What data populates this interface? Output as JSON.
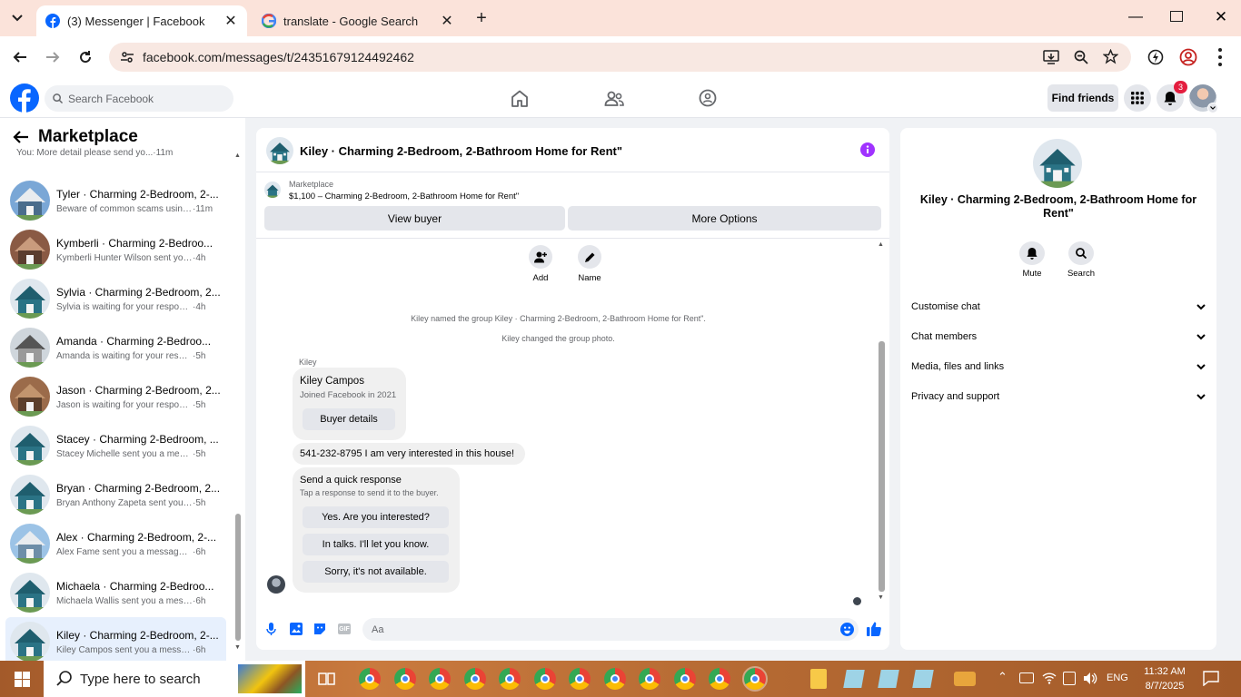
{
  "browser": {
    "tabs": [
      {
        "title": "(3) Messenger | Facebook",
        "active": true
      },
      {
        "title": "translate - Google Search",
        "active": false
      }
    ],
    "url": "facebook.com/messages/t/24351679124492462"
  },
  "header": {
    "search_placeholder": "Search Facebook",
    "find_friends": "Find friends",
    "notification_count": "3"
  },
  "left": {
    "title": "Marketplace",
    "top_preview": "You: More detail please send yo...",
    "top_time": "·11m",
    "conversations": [
      {
        "name": "Tyler · Charming 2-Bedroom, 2-...",
        "preview": "Beware of common scams using...",
        "time": "·11m"
      },
      {
        "name": "Kymberli · Charming 2-Bedroo...",
        "preview": "Kymberli Hunter Wilson sent you a...",
        "time": "·4h"
      },
      {
        "name": "Sylvia · Charming 2-Bedroom, 2...",
        "preview": "Sylvia is waiting for your response.",
        "time": "·4h"
      },
      {
        "name": "Amanda · Charming 2-Bedroo...",
        "preview": "Amanda is waiting for your respo...",
        "time": "·5h"
      },
      {
        "name": "Jason · Charming 2-Bedroom, 2...",
        "preview": "Jason is waiting for your response.",
        "time": "·5h"
      },
      {
        "name": "Stacey · Charming 2-Bedroom, ...",
        "preview": "Stacey Michelle sent you a messag...",
        "time": "·5h"
      },
      {
        "name": "Bryan · Charming 2-Bedroom, 2...",
        "preview": "Bryan Anthony Zapeta sent you a ...",
        "time": "·5h"
      },
      {
        "name": "Alex · Charming 2-Bedroom, 2-...",
        "preview": "Alex Fame sent you a message ab...",
        "time": "·6h"
      },
      {
        "name": "Michaela · Charming 2-Bedroo...",
        "preview": "Michaela Wallis sent you a messag...",
        "time": "·6h"
      },
      {
        "name": "Kiley · Charming 2-Bedroom, 2-...",
        "preview": "Kiley Campos sent you a message ...",
        "time": "·6h"
      }
    ]
  },
  "chat": {
    "title": "Kiley · Charming 2-Bedroom, 2-Bathroom Home for Rent\"",
    "marketplace_label": "Marketplace",
    "listing": "$1,100 – Charming 2-Bedroom, 2-Bathroom Home for Rent\"",
    "view_buyer": "View buyer",
    "more_options": "More Options",
    "add_label": "Add",
    "name_label": "Name",
    "system1": "Kiley named the group Kiley · Charming 2-Bedroom, 2-Bathroom Home for Rent\".",
    "system2": "Kiley changed the group photo.",
    "sender": "Kiley",
    "profile_name": "Kiley Campos",
    "joined": "Joined Facebook in 2021",
    "buyer_details": "Buyer details",
    "message": "541-232-8795 I am very interested in this house!",
    "quick_title": "Send a quick response",
    "quick_sub": "Tap a response to send it to the buyer.",
    "quick_responses": [
      "Yes. Are you interested?",
      "In talks. I'll let you know.",
      "Sorry, it's not available."
    ],
    "composer_placeholder": "Aa"
  },
  "right": {
    "title": "Kiley · Charming 2-Bedroom, 2-Bathroom Home for Rent\"",
    "mute": "Mute",
    "search": "Search",
    "sections": [
      "Customise chat",
      "Chat members",
      "Media, files and links",
      "Privacy and support"
    ]
  },
  "taskbar": {
    "search_placeholder": "Type here to search",
    "lang": "ENG",
    "time": "11:32 AM",
    "date": "8/7/2025"
  },
  "colors": {
    "fb_blue": "#0866ff",
    "messenger_purple": "#a033ff",
    "tab_bg": "#fbe3da"
  }
}
